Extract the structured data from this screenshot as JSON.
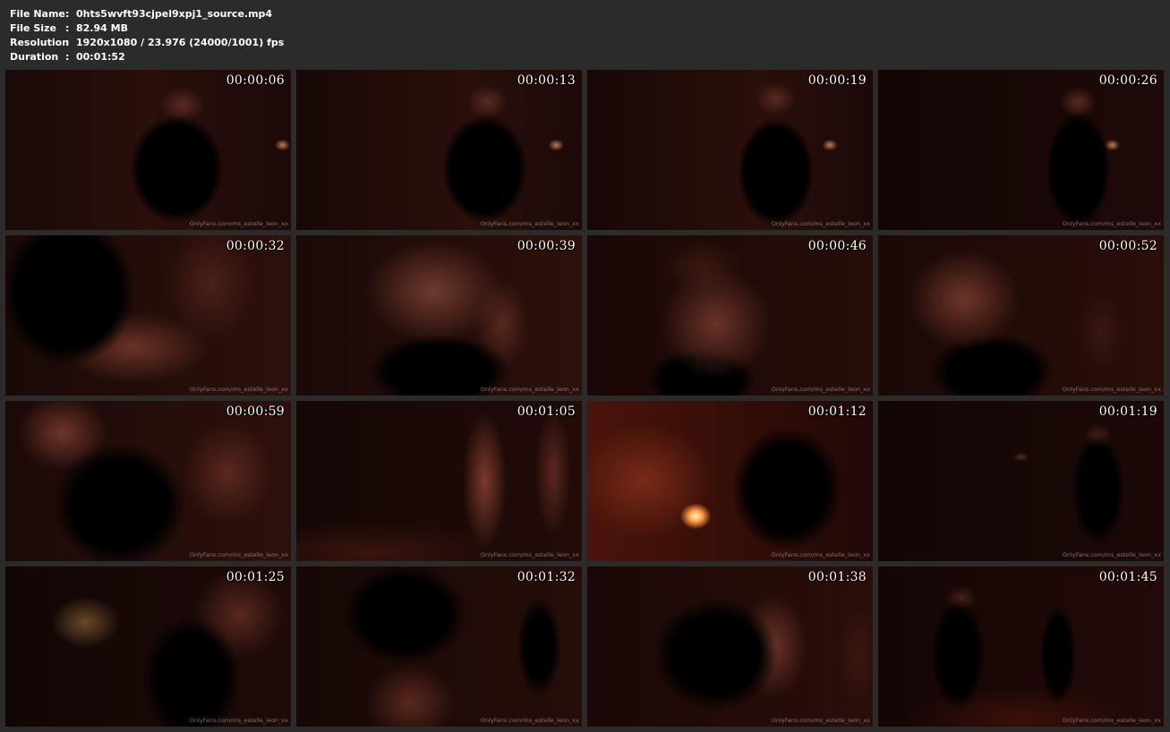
{
  "info": {
    "file_name": {
      "label": "File Name",
      "sep": ":",
      "value": "0hts5wvft93cjpel9xpj1_source.mp4"
    },
    "file_size": {
      "label": "File Size",
      "sep": ":",
      "value": "82.94 MB"
    },
    "resolution": {
      "label": "Resolution",
      "sep": ":",
      "value": "1920x1080 / 23.976 (24000/1001) fps"
    },
    "duration": {
      "label": "Duration",
      "sep": ":",
      "value": "00:01:52"
    }
  },
  "watermark": "OnlyFans.com/ms_estelle_leon_xx",
  "thumbnails": [
    {
      "time": "00:00:06"
    },
    {
      "time": "00:00:13"
    },
    {
      "time": "00:00:19"
    },
    {
      "time": "00:00:26"
    },
    {
      "time": "00:00:32"
    },
    {
      "time": "00:00:39"
    },
    {
      "time": "00:00:46"
    },
    {
      "time": "00:00:52"
    },
    {
      "time": "00:00:59"
    },
    {
      "time": "00:01:05"
    },
    {
      "time": "00:01:12"
    },
    {
      "time": "00:01:19"
    },
    {
      "time": "00:01:25"
    },
    {
      "time": "00:01:32"
    },
    {
      "time": "00:01:38"
    },
    {
      "time": "00:01:45"
    }
  ]
}
